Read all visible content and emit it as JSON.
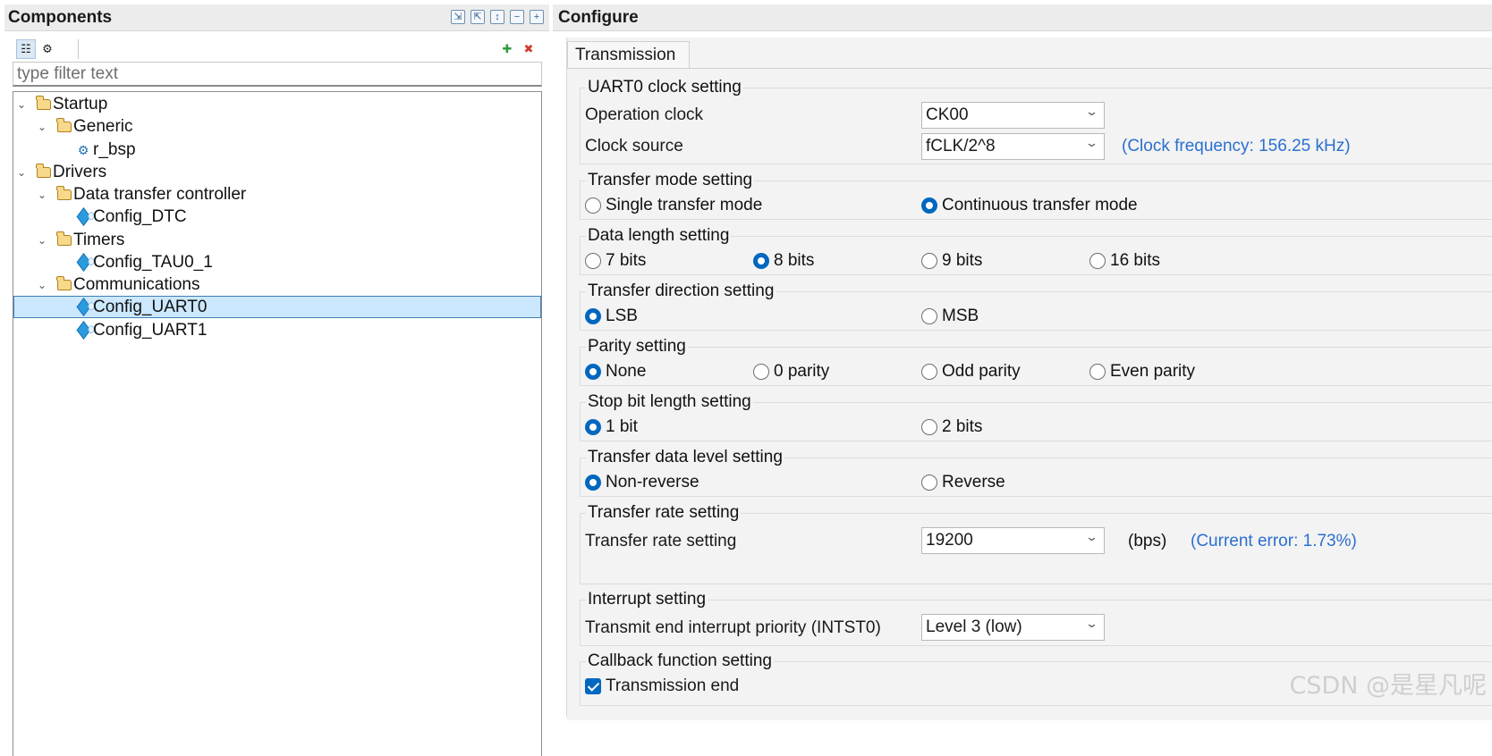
{
  "components": {
    "title": "Components",
    "header_icons": [
      "import-icon",
      "export-icon",
      "sort-icon",
      "collapse-all-icon",
      "expand-all-icon"
    ],
    "toolbar_icons": [
      "tree-view-icon",
      "function-view-icon",
      "add-component-icon",
      "remove-component-icon"
    ],
    "filter_placeholder": "type filter text",
    "tree": [
      {
        "label": "Startup",
        "type": "folder",
        "expanded": true
      },
      {
        "label": "Generic",
        "type": "folder",
        "expanded": true
      },
      {
        "label": "r_bsp",
        "type": "component"
      },
      {
        "label": "Drivers",
        "type": "folder",
        "expanded": true
      },
      {
        "label": "Data transfer controller",
        "type": "folder",
        "expanded": true
      },
      {
        "label": "Config_DTC",
        "type": "component"
      },
      {
        "label": "Timers",
        "type": "folder",
        "expanded": true
      },
      {
        "label": "Config_TAU0_1",
        "type": "component"
      },
      {
        "label": "Communications",
        "type": "folder",
        "expanded": true
      },
      {
        "label": "Config_UART0",
        "type": "component",
        "selected": true
      },
      {
        "label": "Config_UART1",
        "type": "component"
      }
    ]
  },
  "configure": {
    "title": "Configure",
    "tab": "Transmission",
    "clock": {
      "title": "UART0 clock setting",
      "operation_clock_label": "Operation clock",
      "operation_clock_value": "CK00",
      "clock_source_label": "Clock source",
      "clock_source_value": "fCLK/2^8",
      "clock_note": "(Clock frequency: 156.25 kHz)"
    },
    "transfer_mode": {
      "title": "Transfer mode setting",
      "options": [
        "Single transfer mode",
        "Continuous transfer mode"
      ],
      "selected": 1
    },
    "data_length": {
      "title": "Data length setting",
      "options": [
        "7 bits",
        "8 bits",
        "9 bits",
        "16 bits"
      ],
      "selected": 1
    },
    "direction": {
      "title": "Transfer direction setting",
      "options": [
        "LSB",
        "MSB"
      ],
      "selected": 0
    },
    "parity": {
      "title": "Parity setting",
      "options": [
        "None",
        "0 parity",
        "Odd parity",
        "Even parity"
      ],
      "selected": 0
    },
    "stop_bit": {
      "title": "Stop bit length setting",
      "options": [
        "1 bit",
        "2 bits"
      ],
      "selected": 0
    },
    "data_level": {
      "title": "Transfer data level setting",
      "options": [
        "Non-reverse",
        "Reverse"
      ],
      "selected": 0
    },
    "rate": {
      "title": "Transfer rate setting",
      "label": "Transfer rate setting",
      "value": "19200",
      "unit": "(bps)",
      "note": "(Current error: 1.73%)"
    },
    "interrupt": {
      "title": "Interrupt setting",
      "label": "Transmit end interrupt priority (INTST0)",
      "value": "Level 3 (low)"
    },
    "callback": {
      "title": "Callback function setting",
      "checkbox_label": "Transmission end",
      "checked": true
    }
  },
  "watermark": "CSDN @是星凡呢",
  "colors": {
    "accent": "#0067c0",
    "note": "#2a6fcf",
    "selection": "#cce8ff",
    "panel_bg": "#f3f3f3"
  }
}
